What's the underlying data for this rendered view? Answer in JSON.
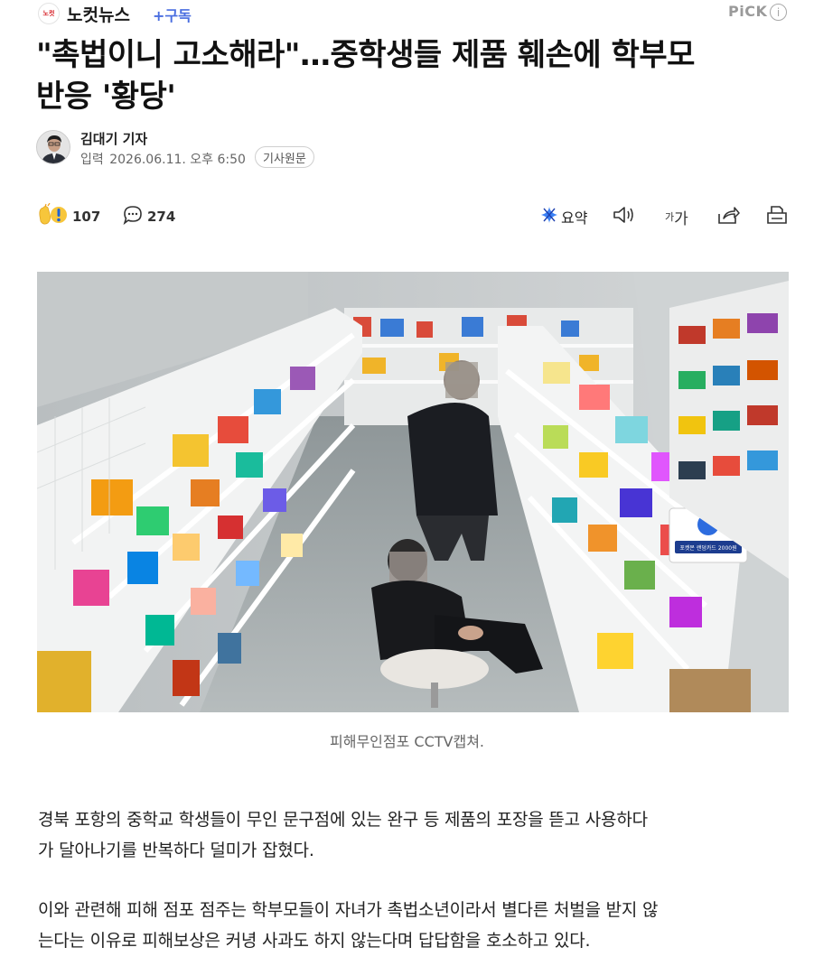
{
  "header": {
    "press_logo_text": "노컷",
    "press_name": "노컷뉴스",
    "subscribe_label": "+구독",
    "pick_label": "PiCK",
    "pick_info_icon": "info-icon"
  },
  "article": {
    "title_line1": "\"촉법이니 고소해라\"…중학생들 제품 훼손에 학부모",
    "title_line2": "반응 '황당'",
    "reporter": "김대기 기자",
    "date_label": "입력",
    "date_value": "2026.06.11. 오후 6:50",
    "original_label": "기사원문"
  },
  "toolbar": {
    "reaction_icon": "clap-surprise-icon",
    "reaction_count": "107",
    "comment_icon": "comment-icon",
    "comment_count": "274",
    "summary_icon": "summary-sparkle-icon",
    "summary_label": "요약",
    "tts_icon": "speaker-icon",
    "font_small": "가",
    "font_big": "가",
    "share_icon": "share-icon",
    "print_icon": "print-icon",
    "accent_color": "#4a6ee0",
    "summary_color": "#3b82f6"
  },
  "photo": {
    "caption": "피해무인점포 CCTV캡쳐.",
    "sign_text": "포켓몬 랜덤카드 2000원"
  },
  "body": {
    "paragraph1_line1": "경북 포항의 중학교 학생들이 무인 문구점에 있는 완구 등 제품의 포장을 뜯고 사용하다",
    "paragraph1_line2": "가 달아나기를 반복하다 덜미가 잡혔다.",
    "paragraph2_line1": "이와 관련해 피해 점포 점주는 학부모들이 자녀가 촉법소년이라서 별다른 처벌을 받지 않",
    "paragraph2_line2": "는다는 이유로 피해보상은 커녕 사과도 하지 않는다며 답답함을 호소하고 있다."
  }
}
